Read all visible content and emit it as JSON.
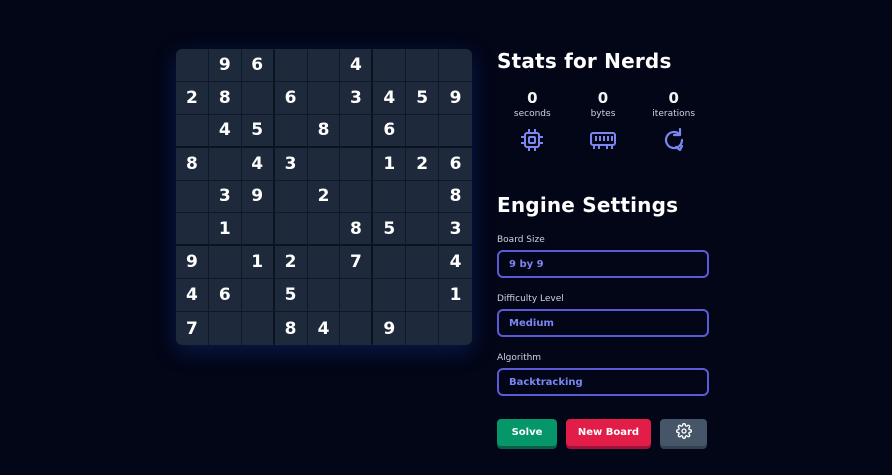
{
  "board": {
    "size": 9,
    "cells": [
      [
        "",
        "9",
        "6",
        "",
        "",
        "4",
        "",
        "",
        ""
      ],
      [
        "2",
        "8",
        "",
        "6",
        "",
        "3",
        "4",
        "5",
        "9"
      ],
      [
        "",
        "4",
        "5",
        "",
        "8",
        "",
        "6",
        "",
        ""
      ],
      [
        "8",
        "",
        "4",
        "3",
        "",
        "",
        "1",
        "2",
        "6"
      ],
      [
        "",
        "3",
        "9",
        "",
        "2",
        "",
        "",
        "",
        "8"
      ],
      [
        "",
        "1",
        "",
        "",
        "",
        "8",
        "5",
        "",
        "3"
      ],
      [
        "9",
        "",
        "1",
        "2",
        "",
        "7",
        "",
        "",
        "4"
      ],
      [
        "4",
        "6",
        "",
        "5",
        "",
        "",
        "",
        "",
        "1"
      ],
      [
        "7",
        "",
        "",
        "8",
        "4",
        "",
        "9",
        "",
        ""
      ]
    ]
  },
  "stats": {
    "title": "Stats for Nerds",
    "items": [
      {
        "value": "0",
        "label": "seconds",
        "icon": "cpu-icon"
      },
      {
        "value": "0",
        "label": "bytes",
        "icon": "memory-icon"
      },
      {
        "value": "0",
        "label": "iterations",
        "icon": "refresh-icon"
      }
    ]
  },
  "engine": {
    "title": "Engine Settings",
    "board_size": {
      "label": "Board Size",
      "value": "9 by 9"
    },
    "difficulty": {
      "label": "Difficulty Level",
      "value": "Medium"
    },
    "algorithm": {
      "label": "Algorithm",
      "value": "Backtracking"
    }
  },
  "actions": {
    "solve_label": "Solve",
    "new_board_label": "New Board",
    "settings_icon": "gear-icon"
  },
  "colors": {
    "background": "#020617",
    "cell": "#1e293b",
    "accent": "#6366f1",
    "solve": "#059669",
    "new_board": "#e11d48",
    "settings": "#475569"
  }
}
